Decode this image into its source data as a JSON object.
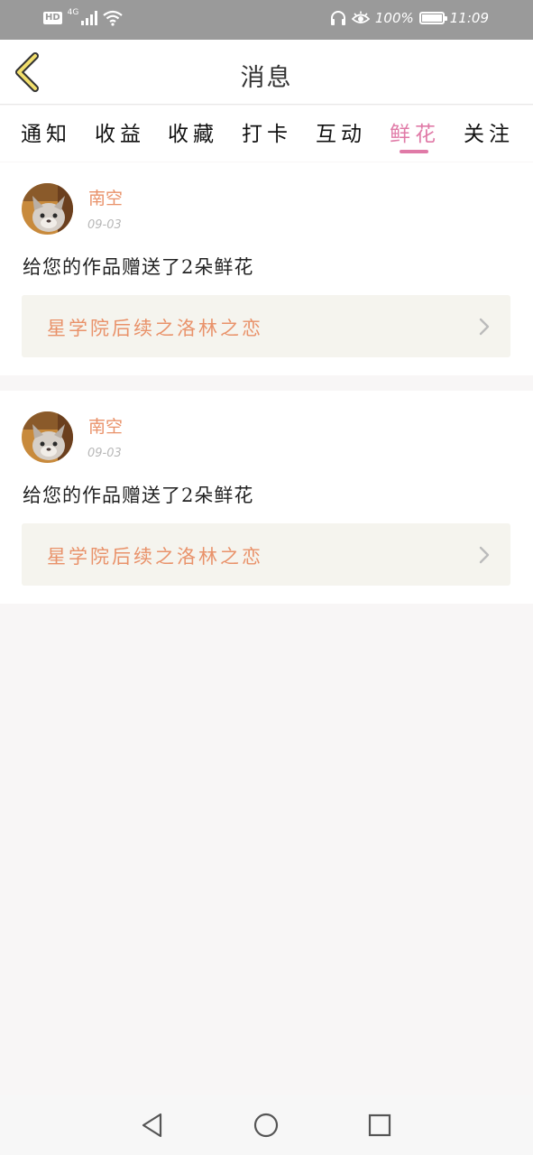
{
  "status_bar": {
    "hd": "HD",
    "network": "4G",
    "battery_percent": "100%",
    "battery_level": 1.0,
    "time": "11:09",
    "icons": [
      "signal-icon",
      "wifi-icon",
      "headphones-icon",
      "eye-icon",
      "battery-icon"
    ]
  },
  "header": {
    "title": "消息",
    "back_icon": "chevron-left-icon",
    "back_icon_color": "#f2df6c"
  },
  "tabs": [
    {
      "label": "通知",
      "active": false
    },
    {
      "label": "收益",
      "active": false
    },
    {
      "label": "收藏",
      "active": false
    },
    {
      "label": "打卡",
      "active": false
    },
    {
      "label": "互动",
      "active": false
    },
    {
      "label": "鲜花",
      "active": true
    },
    {
      "label": "关注",
      "active": false
    }
  ],
  "messages": [
    {
      "sender": "南空",
      "date": "09-03",
      "text": "给您的作品赠送了2朵鲜花",
      "work_title": "星学院后续之洛林之恋",
      "avatar_icon": "cat-avatar"
    },
    {
      "sender": "南空",
      "date": "09-03",
      "text": "给您的作品赠送了2朵鲜花",
      "work_title": "星学院后续之洛林之恋",
      "avatar_icon": "cat-avatar"
    }
  ],
  "nav_bar": {
    "icons": [
      "back-triangle-icon",
      "home-circle-icon",
      "recents-square-icon"
    ]
  },
  "colors": {
    "accent_pink": "#e07aa7",
    "accent_orange": "#e9926a",
    "status_bar": "#9a9a9a"
  }
}
